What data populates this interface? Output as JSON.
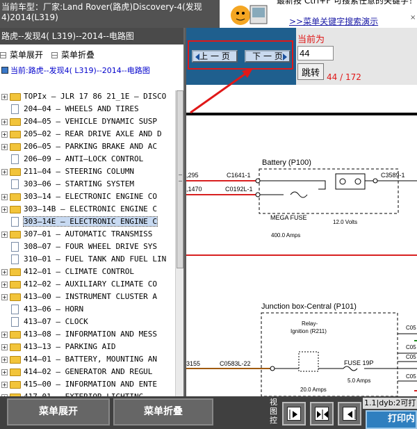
{
  "header": {
    "car_title": "当前车型：厂家:Land Rover(路虎)Discovery-4(发现4)2014(L319)",
    "hint": "最新按 Ctrl+F 可搜索任意的关键字！",
    "link": ">>菜单关键字搜索演示",
    "close": "×"
  },
  "sidebar": {
    "title": "路虎--发现4( L319)--2014--电路图",
    "expand_label": "菜单展开",
    "collapse_label": "菜单折叠",
    "root": "当前:路虎--发现4( L319)--2014--电路图",
    "items": [
      {
        "label": "TOPIx — JLR 17 86 21_1E — DISCO",
        "kind": "folder"
      },
      {
        "label": "204—04 — WHEELS AND TIRES",
        "kind": "doc"
      },
      {
        "label": "204—05 — VEHICLE DYNAMIC SUSP",
        "kind": "folder"
      },
      {
        "label": "205—02 — REAR DRIVE AXLE AND D",
        "kind": "folder"
      },
      {
        "label": "206—05 — PARKING BRAKE AND AC",
        "kind": "folder"
      },
      {
        "label": "206—09 — ANTI—LOCK CONTROL",
        "kind": "doc"
      },
      {
        "label": "211—04 — STEERING COLUMN",
        "kind": "folder"
      },
      {
        "label": "303—06 — STARTING SYSTEM",
        "kind": "doc"
      },
      {
        "label": "303—14 — ELECTRONIC ENGINE CO",
        "kind": "folder"
      },
      {
        "label": "303—14B — ELECTRONIC ENGINE C",
        "kind": "folder"
      },
      {
        "label": "303—14E — ELECTRONIC ENGINE C",
        "kind": "doc",
        "selected": true
      },
      {
        "label": "307—01 — AUTOMATIC TRANSMISS",
        "kind": "folder"
      },
      {
        "label": "308—07 — FOUR WHEEL DRIVE SYS",
        "kind": "doc"
      },
      {
        "label": "310—01 — FUEL TANK AND FUEL LIN",
        "kind": "doc"
      },
      {
        "label": "412—01 — CLIMATE CONTROL",
        "kind": "folder"
      },
      {
        "label": "412—02 — AUXILIARY CLIMATE CO",
        "kind": "folder"
      },
      {
        "label": "413—00 — INSTRUMENT CLUSTER A",
        "kind": "folder"
      },
      {
        "label": "413—06 — HORN",
        "kind": "doc"
      },
      {
        "label": "413—07 — CLOCK",
        "kind": "doc"
      },
      {
        "label": "413—08 — INFORMATION AND MESS",
        "kind": "folder"
      },
      {
        "label": "413—13 — PARKING AID",
        "kind": "folder"
      },
      {
        "label": "414—01 — BATTERY, MOUNTING AN",
        "kind": "folder"
      },
      {
        "label": "414—02 — GENERATOR AND REGUL",
        "kind": "folder"
      },
      {
        "label": "415—00 — INFORMATION AND ENTE",
        "kind": "folder"
      },
      {
        "label": "417—01 — EXTERIOR LIGHTING",
        "kind": "folder"
      }
    ]
  },
  "pager": {
    "prev_label": "上 一 页",
    "next_label": "下 一 页",
    "current_label": "当前为",
    "page_value": "44",
    "jump_label": "跳转",
    "count": "44 / 172"
  },
  "diagram": {
    "battery_title": "Battery (P100)",
    "wire1_left": ",295",
    "wire2_left": ",1470",
    "conn_c1641": "C1641-1",
    "conn_c0192": "C0192L-1",
    "mega_fuse": "MEGA FUSE",
    "mega_amps": "400.0 Amps",
    "battery_volts": "12.0 Volts",
    "conn_c3589": "C3589-1",
    "junction_title": "Junction box-Central (P101)",
    "relay_label": "Relay-",
    "relay_sub": "Ignition (R211)",
    "wire3_left": "3155",
    "conn_c0583": "C0583L-22",
    "fuse19": "FUSE 19P",
    "fuse19_amps": "5.0 Amps",
    "relay_amps": "20.0 Amps",
    "c05_labels": [
      "C05",
      "C05",
      "C05",
      "C05"
    ]
  },
  "bottom": {
    "expand_label": "菜单展开",
    "collapse_label": "菜单折叠",
    "view_label": "视图控",
    "status": "1.1|dyb:2可打",
    "print_label": "打印内"
  }
}
